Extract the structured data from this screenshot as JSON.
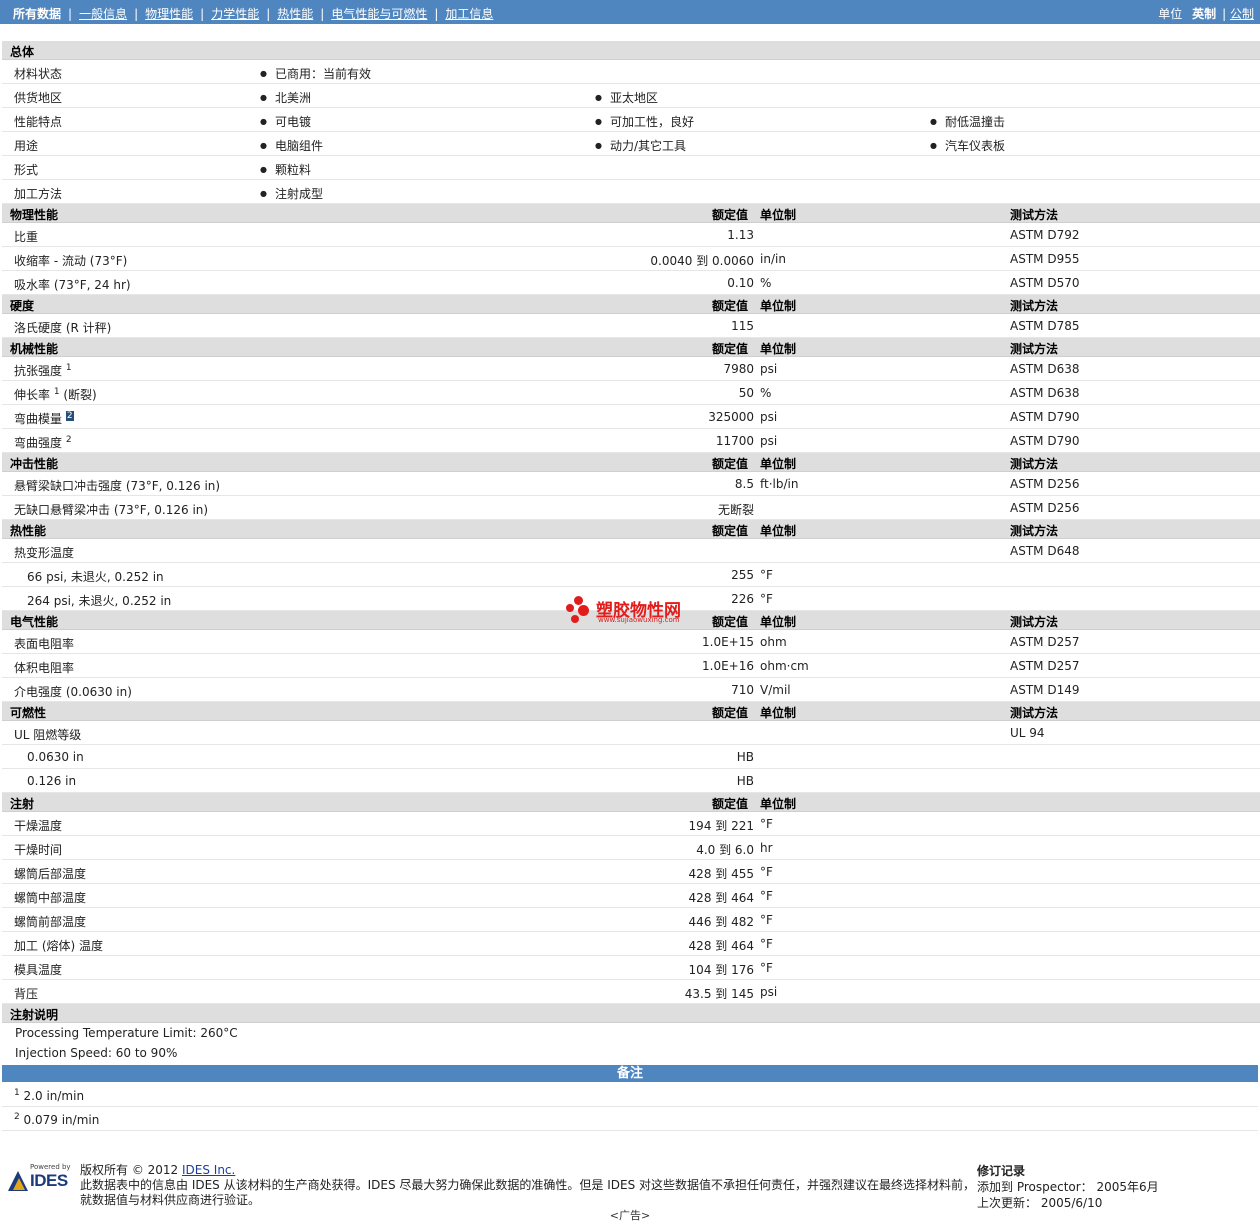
{
  "nav": {
    "items": [
      "所有数据",
      "一般信息",
      "物理性能",
      "力学性能",
      "热性能",
      "电气性能与可燃性",
      "加工信息"
    ],
    "units_label": "单位",
    "unit_current": "英制",
    "unit_other": "公制"
  },
  "general": {
    "title": "总体",
    "rows": [
      {
        "label": "材料状态",
        "values": [
          "已商用：当前有效"
        ]
      },
      {
        "label": "供货地区",
        "values": [
          "北美洲",
          "亚太地区"
        ]
      },
      {
        "label": "性能特点",
        "values": [
          "可电镀",
          "可加工性，良好",
          "耐低温撞击"
        ]
      },
      {
        "label": "用途",
        "values": [
          "电脑组件",
          "动力/其它工具",
          "汽车仪表板"
        ]
      },
      {
        "label": "形式",
        "values": [
          "颗粒料"
        ]
      },
      {
        "label": "加工方法",
        "values": [
          "注射成型"
        ]
      }
    ]
  },
  "headers": {
    "value": "额定值",
    "unit": "单位制",
    "method": "测试方法"
  },
  "physical": {
    "title": "物理性能",
    "rows": [
      {
        "label": "比重",
        "value": "1.13",
        "unit": "",
        "method": "ASTM D792"
      },
      {
        "label": "收缩率 - 流动 (73°F)",
        "value": "0.0040 到  0.0060",
        "unit": "in/in",
        "method": "ASTM D955"
      },
      {
        "label": "吸水率 (73°F, 24 hr)",
        "value": "0.10",
        "unit": "%",
        "method": "ASTM D570"
      }
    ]
  },
  "hardness": {
    "title": "硬度",
    "rows": [
      {
        "label": "洛氏硬度 (R 计秤)",
        "value": "115",
        "unit": "",
        "method": "ASTM D785"
      }
    ]
  },
  "mechanical": {
    "title": "机械性能",
    "rows": [
      {
        "label": "抗张强度",
        "sup": "1",
        "suffix": "",
        "value": "7980",
        "unit": "psi",
        "method": "ASTM D638"
      },
      {
        "label": "伸长率",
        "sup": "1",
        "suffix": " (断裂)",
        "value": "50",
        "unit": "%",
        "method": "ASTM D638"
      },
      {
        "label": "弯曲模量",
        "sup": "2",
        "suffix": "",
        "value": "325000",
        "unit": "psi",
        "method": "ASTM D790"
      },
      {
        "label": "弯曲强度",
        "sup": "2",
        "suffix": "",
        "value": "11700",
        "unit": "psi",
        "method": "ASTM D790"
      }
    ]
  },
  "impact": {
    "title": "冲击性能",
    "rows": [
      {
        "label": "悬臂梁缺口冲击强度 (73°F, 0.126 in)",
        "value": "8.5",
        "unit": "ft·lb/in",
        "method": "ASTM D256"
      },
      {
        "label": "无缺口悬臂梁冲击 (73°F, 0.126 in)",
        "value": "无断裂",
        "unit": "",
        "method": "ASTM D256"
      }
    ]
  },
  "thermal": {
    "title": "热性能",
    "rows": [
      {
        "label": "热变形温度",
        "value": "",
        "unit": "",
        "method": "ASTM D648",
        "indent": false
      },
      {
        "label": "66 psi, 未退火, 0.252 in",
        "value": "255",
        "unit": "°F",
        "method": "",
        "indent": true
      },
      {
        "label": "264 psi, 未退火, 0.252 in",
        "value": "226",
        "unit": "°F",
        "method": "",
        "indent": true
      }
    ]
  },
  "electrical": {
    "title": "电气性能",
    "rows": [
      {
        "label": "表面电阻率",
        "value": "1.0E+15",
        "unit": "ohm",
        "method": "ASTM D257"
      },
      {
        "label": "体积电阻率",
        "value": "1.0E+16",
        "unit": "ohm·cm",
        "method": "ASTM D257"
      },
      {
        "label": "介电强度 (0.0630 in)",
        "value": "710",
        "unit": "V/mil",
        "method": "ASTM D149"
      }
    ]
  },
  "flammability": {
    "title": "可燃性",
    "rows": [
      {
        "label": "UL 阻燃等级",
        "value": "",
        "unit": "",
        "method": "UL 94",
        "indent": false
      },
      {
        "label": "0.0630 in",
        "value": "HB",
        "unit": "",
        "method": "",
        "indent": true
      },
      {
        "label": "0.126 in",
        "value": "HB",
        "unit": "",
        "method": "",
        "indent": true
      }
    ]
  },
  "injection": {
    "title": "注射",
    "rows": [
      {
        "label": "干燥温度",
        "value": "194 到  221",
        "unit": "°F"
      },
      {
        "label": "干燥时间",
        "value": "4.0 到  6.0",
        "unit": "hr"
      },
      {
        "label": "螺筒后部温度",
        "value": "428 到  455",
        "unit": "°F"
      },
      {
        "label": "螺筒中部温度",
        "value": "428 到  464",
        "unit": "°F"
      },
      {
        "label": "螺筒前部温度",
        "value": "446 到  482",
        "unit": "°F"
      },
      {
        "label": "加工 (熔体) 温度",
        "value": "428 到  464",
        "unit": "°F"
      },
      {
        "label": "模具温度",
        "value": "104 到  176",
        "unit": "°F"
      },
      {
        "label": "背压",
        "value": "43.5 到  145",
        "unit": "psi"
      }
    ]
  },
  "injection_notes": {
    "title": "注射说明",
    "lines": [
      "Processing Temperature Limit: 260°C",
      "Injection Speed: 60 to 90%"
    ]
  },
  "remarks": {
    "title": "备注",
    "items": [
      {
        "num": "1",
        "text": "2.0 in/min"
      },
      {
        "num": "2",
        "text": "0.079 in/min"
      }
    ]
  },
  "footer": {
    "powered_by": "Powered by",
    "logo_text": "IDES",
    "copyright_prefix": "版权所有 © 2012 ",
    "copyright_link": "IDES Inc.",
    "disclaimer_1": "此数据表中的信息由 IDES 从该材料的生产商处获得。IDES 尽最大努力确保此数据的准确性。但是 IDES 对这些数据值不承担任何责任，并强烈建议在最终选择材料前，",
    "disclaimer_2": "就数据值与材料供应商进行验证。",
    "revision_title": "修订记录",
    "added_label": "添加到 Prospector： 2005年6月",
    "updated_label": "上次更新： 2005/6/10"
  },
  "ad_text": "<广告>",
  "watermark": {
    "title": "塑胶物性网",
    "url": "www.sujiaowuxing.com"
  }
}
